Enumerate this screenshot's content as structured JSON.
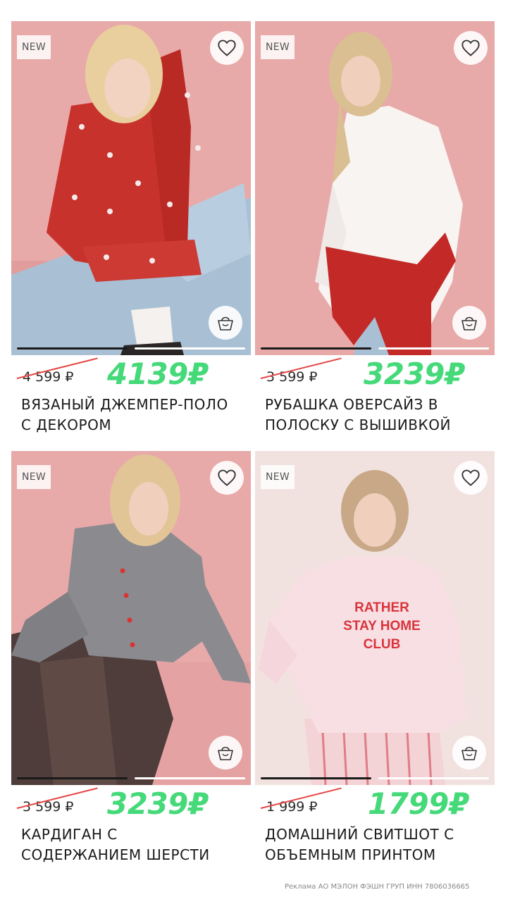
{
  "products": [
    {
      "badge": "NEW",
      "old_price": "4 599 ₽",
      "new_price": "4139₽",
      "title_line1": "ВЯЗАНЫЙ ДЖЕМПЕР-ПОЛО",
      "title_line2": "С ДЕКОРОМ",
      "favorite_icon": "heart-outline",
      "cart_icon": "basket",
      "gallery_active": 1,
      "gallery_count": 2
    },
    {
      "badge": "NEW",
      "old_price": "3 599 ₽",
      "new_price": "3239₽",
      "title_line1": "РУБАШКА ОВЕРСАЙЗ В",
      "title_line2": "ПОЛОСКУ С ВЫШИВКОЙ",
      "favorite_icon": "heart-outline",
      "cart_icon": "basket",
      "gallery_active": 1,
      "gallery_count": 2
    },
    {
      "badge": "NEW",
      "old_price": "3 599 ₽",
      "new_price": "3239₽",
      "title_line1": "КАРДИГАН С",
      "title_line2": "СОДЕРЖАНИЕМ ШЕРСТИ",
      "favorite_icon": "heart-outline",
      "cart_icon": "basket",
      "gallery_active": 1,
      "gallery_count": 2
    },
    {
      "badge": "NEW",
      "old_price": "1 999 ₽",
      "new_price": "1799₽",
      "title_line1": "ДОМАШНИЙ СВИТШОТ С",
      "title_line2": "ОБЪЕМНЫМ ПРИНТОМ",
      "favorite_icon": "heart-outline",
      "cart_icon": "basket",
      "gallery_active": 1,
      "gallery_count": 2,
      "print_line1": "RATHER",
      "print_line2": "STAY HOME",
      "print_line3": "CLUB"
    }
  ],
  "footer_text": "Реклама АО МЭЛОН ФЭШН ГРУП ИНН 7806036665",
  "colors": {
    "new_price": "#45d97a",
    "strike": "#e64545",
    "photo_bg_pink": "#e8a9a9",
    "photo_bg_light": "#f1e2df"
  }
}
